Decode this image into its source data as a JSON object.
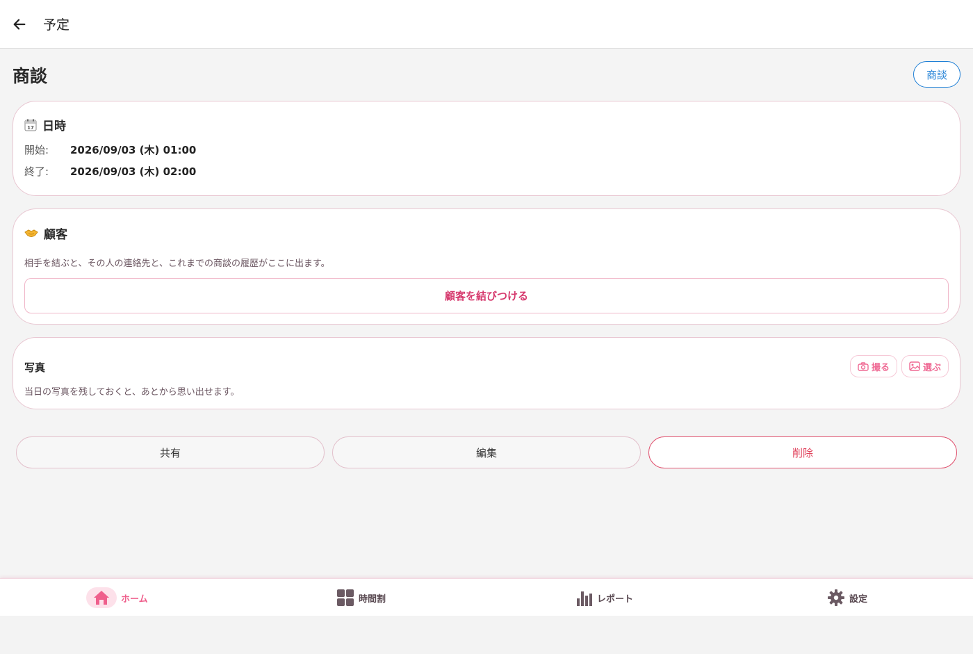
{
  "appbar": {
    "title": "予定",
    "back_icon": "arrow-left-icon"
  },
  "page": {
    "title": "商談",
    "type_chip": "商談"
  },
  "datetime_card": {
    "icon": "calendar-icon",
    "title": "日時",
    "start_label": "開始:",
    "start_value": "2026/09/03 (木) 01:00",
    "end_label": "終了:",
    "end_value": "2026/09/03 (木) 02:00"
  },
  "customer_card": {
    "icon": "handshake-icon",
    "title": "顧客",
    "description": "相手を結ぶと、その人の連絡先と、これまでの商談の履歴がここに出ます。",
    "link_button": "顧客を結びつける"
  },
  "photo_card": {
    "title": "写真",
    "description": "当日の写真を残しておくと、あとから思い出せます。",
    "take_button": "撮る",
    "choose_button": "選ぶ"
  },
  "actions": {
    "share": "共有",
    "edit": "編集",
    "delete": "削除"
  },
  "bottom_nav": {
    "items": [
      {
        "label": "ホーム",
        "icon": "home-icon",
        "active": true
      },
      {
        "label": "時間割",
        "icon": "grid-icon",
        "active": false
      },
      {
        "label": "レポート",
        "icon": "bar-chart-icon",
        "active": false
      },
      {
        "label": "設定",
        "icon": "gear-icon",
        "active": false
      }
    ]
  },
  "colors": {
    "accent_pink": "#ef5f8c",
    "chip_blue": "#1e7fd6",
    "danger": "#e0425c"
  }
}
